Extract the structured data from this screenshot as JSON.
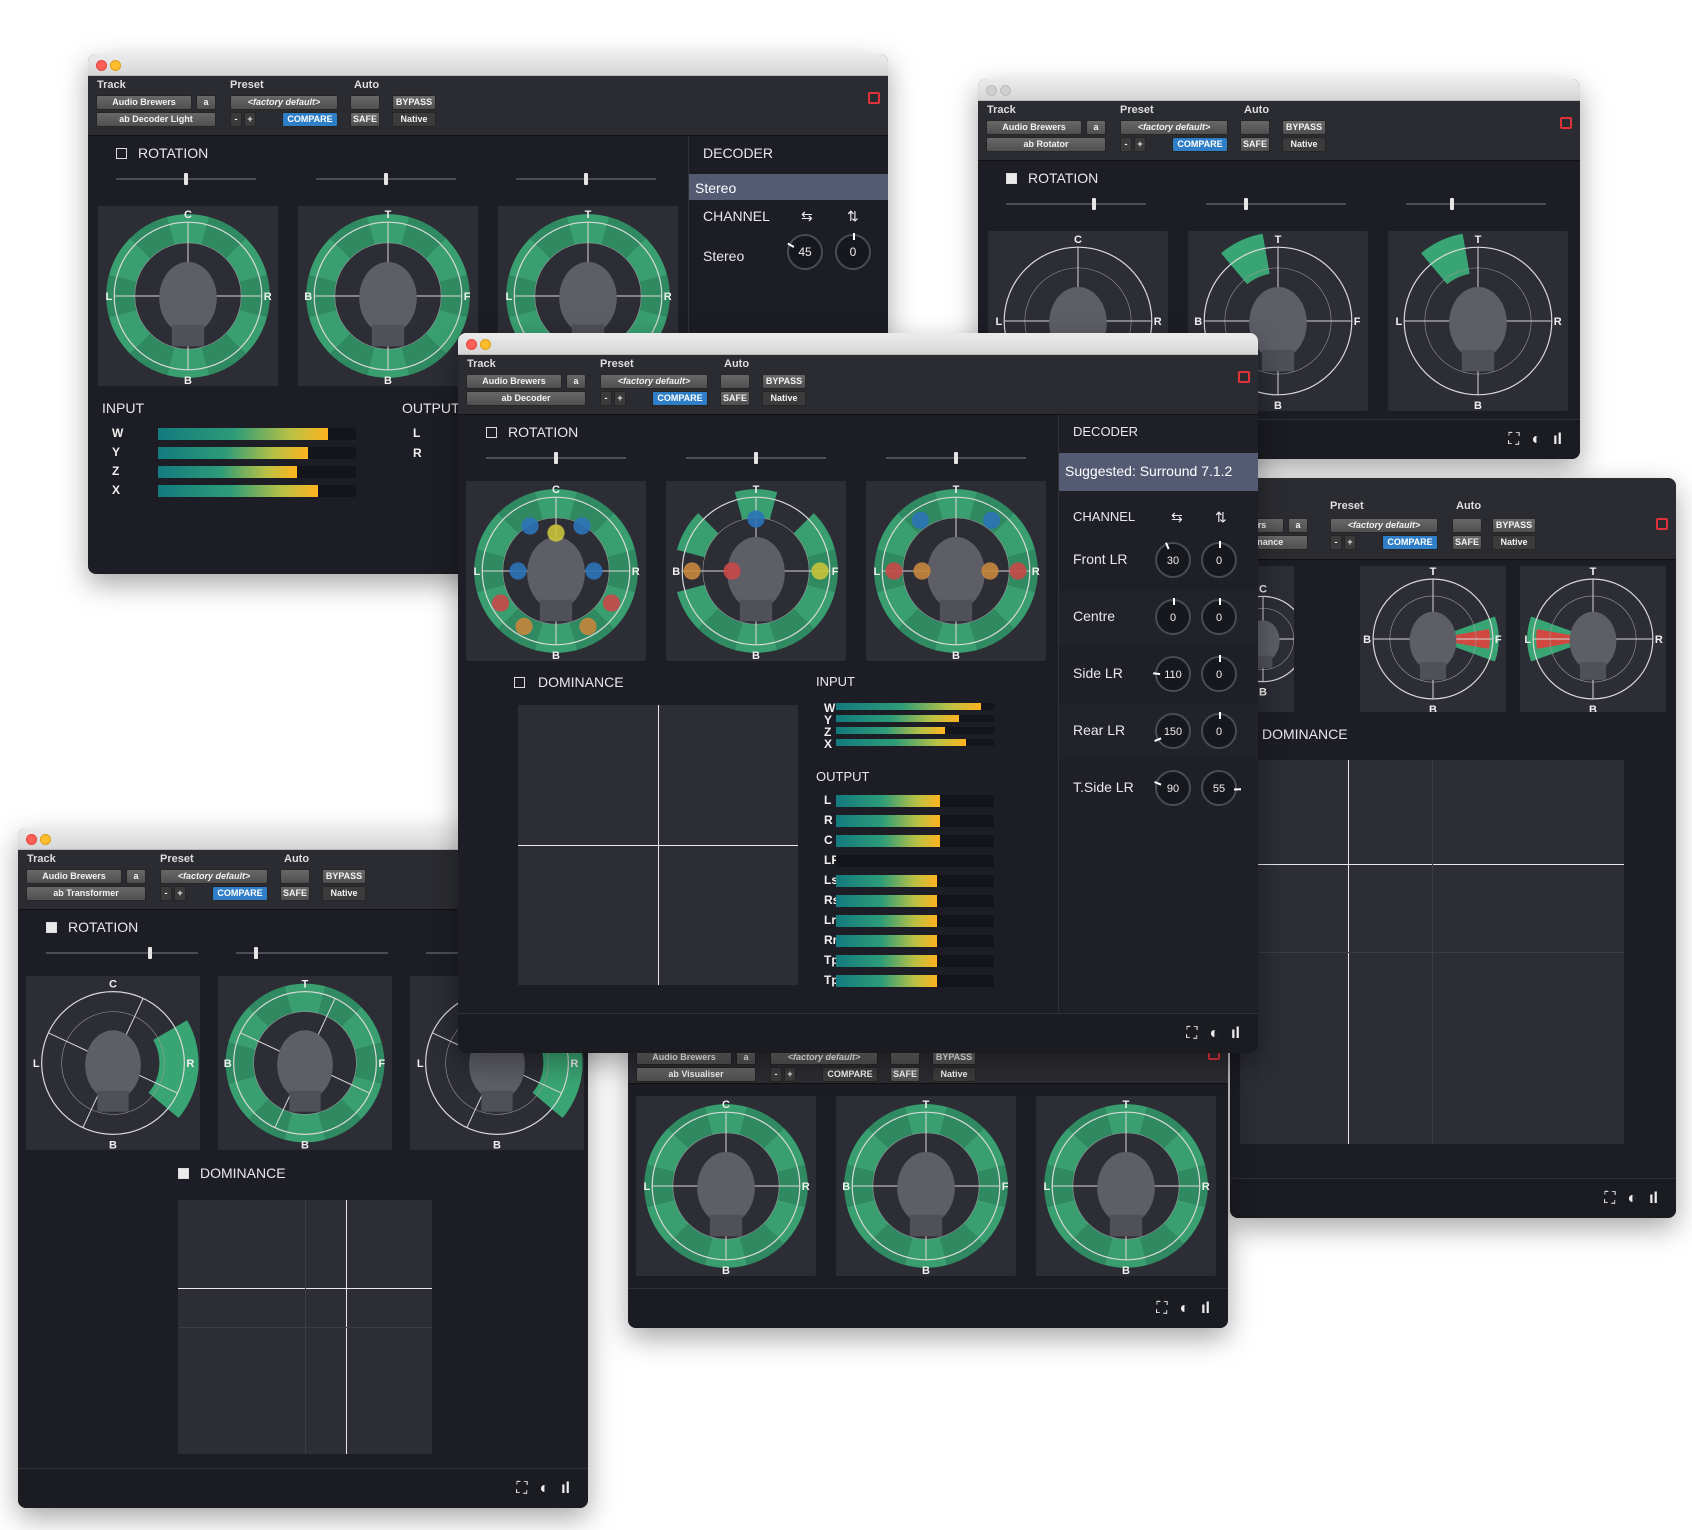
{
  "common": {
    "track_label": "Track",
    "preset_label": "Preset",
    "auto_label": "Auto",
    "vendor": "Audio Brewers",
    "channel_a": "a",
    "preset_value": "<factory default>",
    "minus": "-",
    "plus": "+",
    "compare": "COMPARE",
    "bypass": "BYPASS",
    "safe": "SAFE",
    "native": "Native",
    "rotation": "ROTATION",
    "dominance": "DOMINANCE",
    "decoder": "DECODER",
    "channel": "CHANNEL",
    "input": "INPUT",
    "output": "OUTPUT"
  },
  "windows": {
    "decoder_light": {
      "plugin": "ab Decoder Light",
      "mode": "Stereo",
      "channel_name": "Stereo",
      "knob_a": "45",
      "knob_b": "0",
      "input_rows": [
        "W",
        "Y",
        "Z",
        "X"
      ],
      "input_levels": [
        0.86,
        0.76,
        0.7,
        0.81
      ],
      "output_rows": [
        "L",
        "R"
      ]
    },
    "rotator": {
      "plugin": "ab Rotator"
    },
    "transformer": {
      "plugin": "ab Transformer"
    },
    "visualiser": {
      "plugin": "ab Visualiser"
    },
    "dominance_win": {
      "plugin_partial": "inance",
      "vendor_partial": "vers"
    },
    "decoder": {
      "plugin": "ab Decoder",
      "suggested": "Suggested: Surround 7.1.2",
      "channels": [
        {
          "name": "Front LR",
          "a": "30",
          "b": "0"
        },
        {
          "name": "Centre",
          "a": "0",
          "b": "0"
        },
        {
          "name": "Side LR",
          "a": "110",
          "b": "0"
        },
        {
          "name": "Rear LR",
          "a": "150",
          "b": "0"
        },
        {
          "name": "T.Side LR",
          "a": "90",
          "b": "55"
        }
      ],
      "input_rows": [
        "W",
        "Y",
        "Z",
        "X"
      ],
      "input_levels": [
        0.92,
        0.78,
        0.69,
        0.82
      ],
      "output_rows": [
        "L",
        "R",
        "C",
        "LFE",
        "Lss",
        "Rss",
        "Lrs",
        "Rrs",
        "TpSiL",
        "TpSiR"
      ],
      "output_levels": [
        0.66,
        0.66,
        0.66,
        0,
        0.64,
        0.64,
        0.64,
        0.64,
        0.64,
        0.64
      ]
    }
  },
  "scopes": {
    "front": {
      "top": "C",
      "left": "L",
      "right": "R",
      "bottom": "B"
    },
    "side": {
      "top": "T",
      "left": "B",
      "right": "F",
      "bottom": "B"
    },
    "rear": {
      "top": "T",
      "left": "L",
      "right": "R",
      "bottom": "B"
    }
  },
  "icons": [
    "expand-icon",
    "contrast-icon",
    "audio-brewers-logo-icon"
  ],
  "colors": {
    "green": "#3aa574",
    "panel": "#1d1e25",
    "accent_blue": "#2f7fc8",
    "suggest_band": "#555a73",
    "red": "#e0323a"
  }
}
